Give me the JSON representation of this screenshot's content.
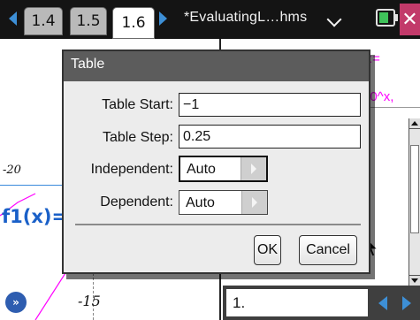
{
  "tabs": [
    {
      "label": "1.4"
    },
    {
      "label": "1.5"
    },
    {
      "label": "1.6"
    }
  ],
  "document_title": "*EvaluatingL…hms",
  "background": {
    "graph_tick_label": "-20",
    "function_label": "f1(x)=",
    "graph_label_bottom": "-15",
    "pink_text_top": "):=",
    "pink_text_mid": "10^x,",
    "entry_line": "1."
  },
  "dialog": {
    "title": "Table",
    "table_start_label": "Table Start:",
    "table_start_value": "−1",
    "table_step_label": "Table Step:",
    "table_step_value": "0.25",
    "independent_label": "Independent:",
    "independent_value": "Auto",
    "dependent_label": "Dependent:",
    "dependent_value": "Auto",
    "ok_label": "OK",
    "cancel_label": "Cancel"
  },
  "colors": {
    "accent_blue": "#3d8fd6",
    "function_blue": "#1a60c8",
    "curve_pink": "#ff00ff",
    "close_tab": "#c23a6a"
  }
}
